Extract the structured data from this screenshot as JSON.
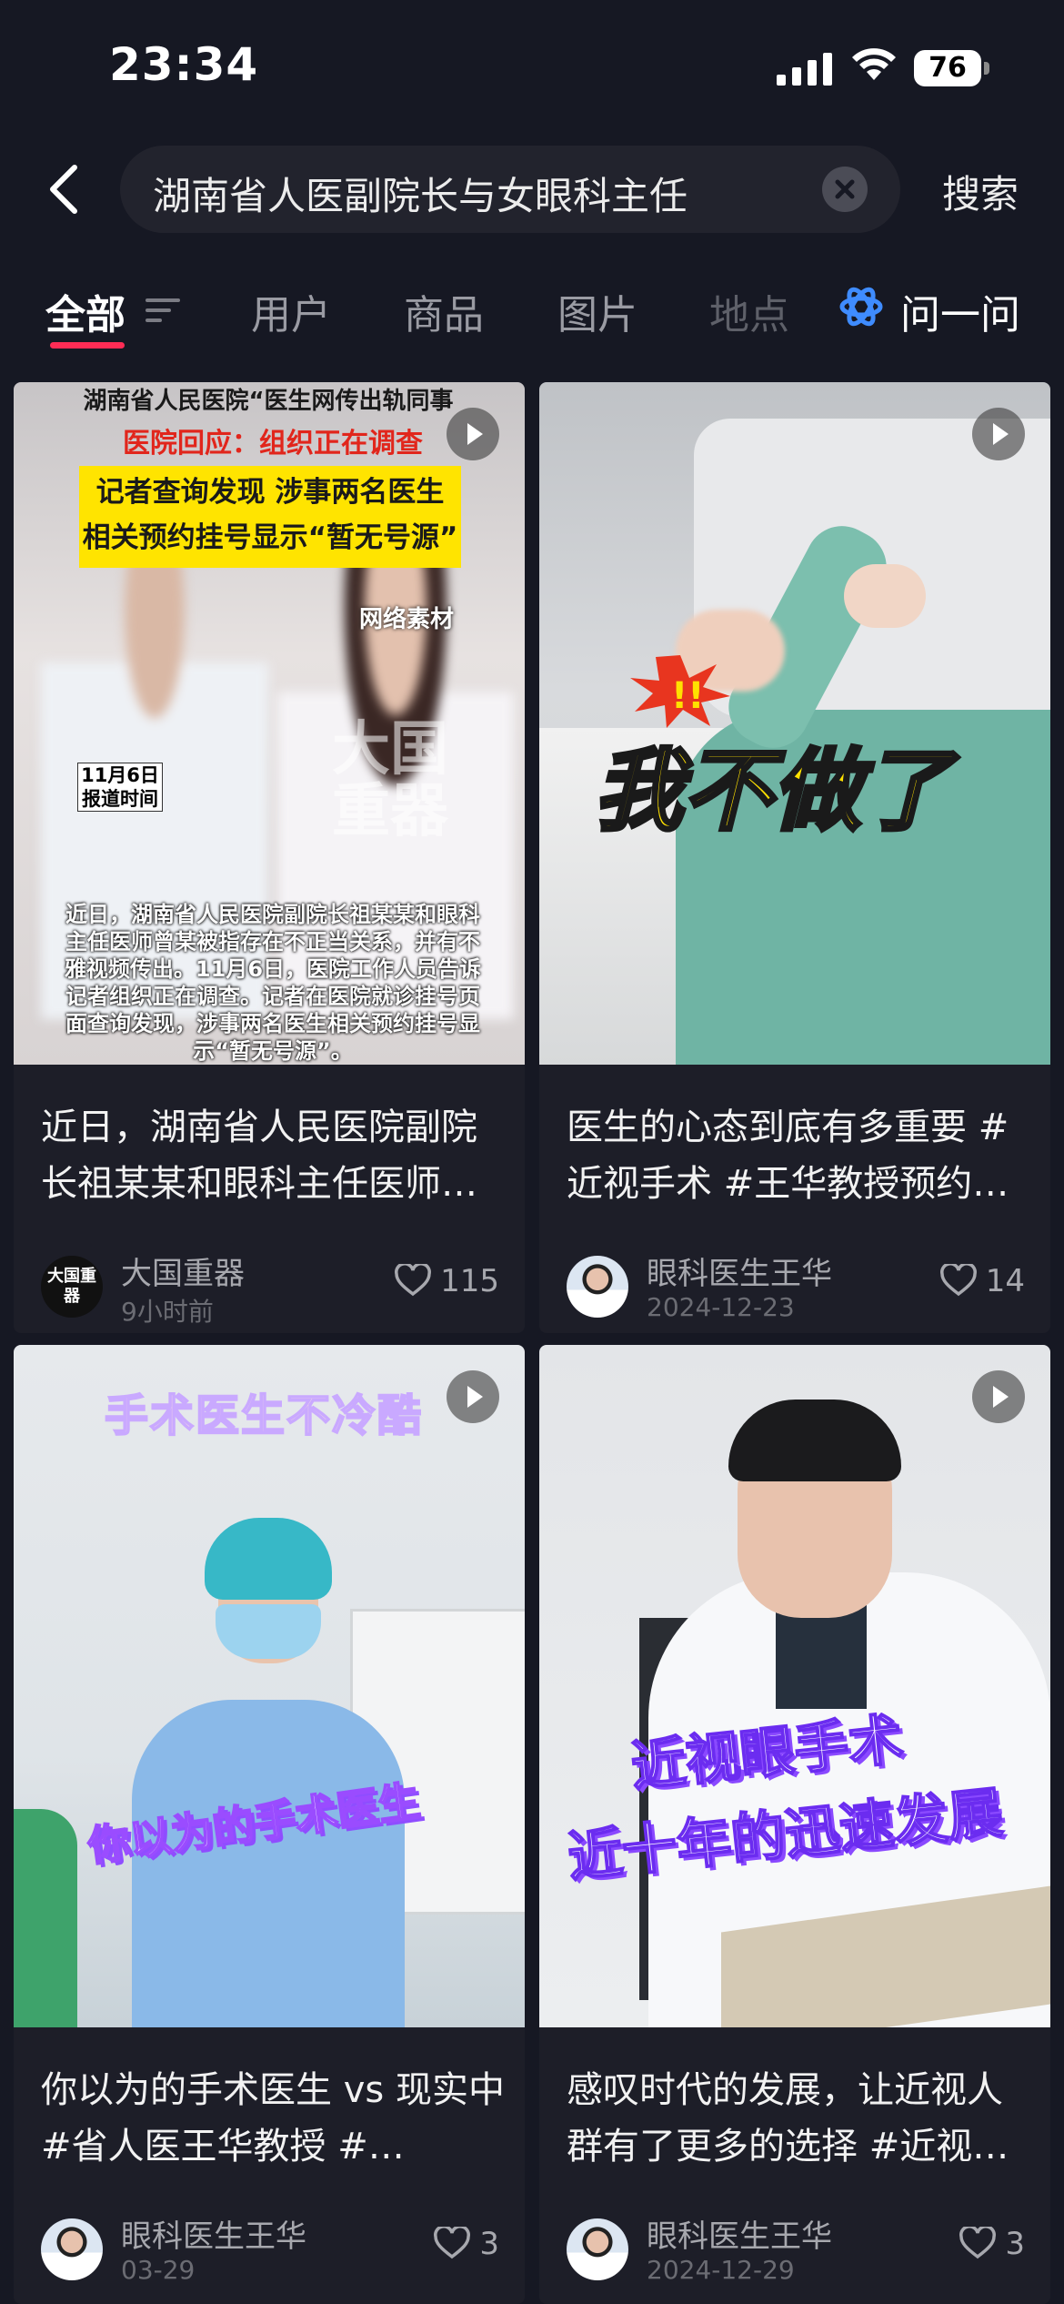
{
  "status_bar": {
    "time": "23:34",
    "battery": "76"
  },
  "search": {
    "query": "湖南省人医副院长与女眼科主任",
    "submit_label": "搜索"
  },
  "tabs": [
    {
      "label": "全部",
      "active": true
    },
    {
      "label": "用户"
    },
    {
      "label": "商品"
    },
    {
      "label": "图片"
    },
    {
      "label": "地点"
    },
    {
      "label": "问一问"
    }
  ],
  "accent_color": "#fe2c55",
  "cards": [
    {
      "cover": {
        "top_line": "湖南省人民医院“医生网传出轨同事",
        "red_line": "医院回应：组织正在调查",
        "yellow_line1": "记者查询发现 涉事两名医生",
        "yellow_line2": "相关预约挂号显示“暂无号源”",
        "tag": "网络素材",
        "date_line1": "11月6日",
        "date_line2": "报道时间",
        "watermark": "大国重器",
        "body": "近日，湖南省人民医院副院长祖某某和眼科主任医师曾某被指存在不正当关系，并有不雅视频传出。11月6日，医院工作人员告诉记者组织正在调查。记者在医院就诊挂号页面查询发现，涉事两名医生相关预约挂号显示“暂无号源”。"
      },
      "description": "近日，湖南省人民医院副院长祖某某和眼科主任医师…",
      "author": "大国重器",
      "avatar_text": "大国重器",
      "time": "9小时前",
      "likes": "115"
    },
    {
      "cover": {
        "caption": "我不做了"
      },
      "description": "医生的心态到底有多重要 #近视手术 #王华教授预约…",
      "author": "眼科医生王华",
      "time": "2024-12-23",
      "likes": "14"
    },
    {
      "cover": {
        "title": "手术医生不冷酷",
        "caption": "你以为的手术医生"
      },
      "description": "你以为的手术医生 vs 现实中 #省人医王华教授 #…",
      "author": "眼科医生王华",
      "time": "03-29",
      "likes": "3"
    },
    {
      "cover": {
        "caption1": "近视眼手术",
        "caption2": "近十年的迅速发展"
      },
      "description": "感叹时代的发展，让近视人群有了更多的选择 #近视…",
      "author": "眼科医生王华",
      "time": "2024-12-29",
      "likes": "3"
    }
  ]
}
